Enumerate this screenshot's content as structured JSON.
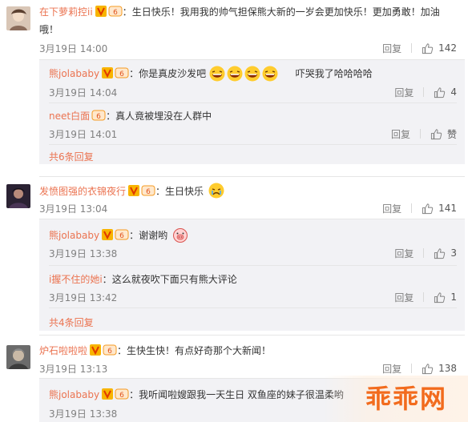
{
  "comments": [
    {
      "user": "在下萝莉控ii",
      "separator": "：",
      "text": "生日快乐！我用我的帅气担保熊大新的一岁会更加快乐！更加勇敢！加油哦！",
      "time": "3月19日 14:00",
      "reply": "回复",
      "likes": "142",
      "replies": [
        {
          "user": "熊jolababy",
          "separator": "：",
          "text": "你是真皮沙发吧",
          "text2": "吓哭我了哈哈哈哈",
          "time": "3月19日 14:04",
          "reply": "回复",
          "likes": "4"
        },
        {
          "user": "neet白面",
          "separator": "：",
          "text": "真人竟被埋没在人群中",
          "time": "3月19日 14:01",
          "reply": "回复",
          "likes": "赞"
        }
      ],
      "more": "共6条回复"
    },
    {
      "user": "发愤图强的衣锦夜行",
      "separator": "：",
      "text": "生日快乐",
      "time": "3月19日 13:04",
      "reply": "回复",
      "likes": "141",
      "replies": [
        {
          "user": "熊jolababy",
          "separator": "：",
          "text": "谢谢哟",
          "time": "3月19日 13:38",
          "reply": "回复",
          "likes": "3"
        },
        {
          "user": "i握不住的她i",
          "separator": "：",
          "text": "这么就夜吹下面只有熊大评论",
          "time": "3月19日 13:42",
          "reply": "回复",
          "likes": "1"
        }
      ],
      "more": "共4条回复"
    },
    {
      "user": "炉石啦啦啦",
      "separator": "：",
      "text": "生快生快！有点好奇那个大新闻！",
      "time": "3月19日 13:13",
      "reply": "回复",
      "likes": "138",
      "replies": [
        {
          "user": "熊jolababy",
          "separator": "：",
          "text": "我听闻啦嫂跟我一天生日  双鱼座的妹子很温柔哟",
          "time": "3月19日 13:38"
        }
      ]
    }
  ],
  "watermark": "乖乖网",
  "colors": {
    "link": "#eb7350",
    "meta": "#808080",
    "sub_bg": "#f2f2f5"
  }
}
